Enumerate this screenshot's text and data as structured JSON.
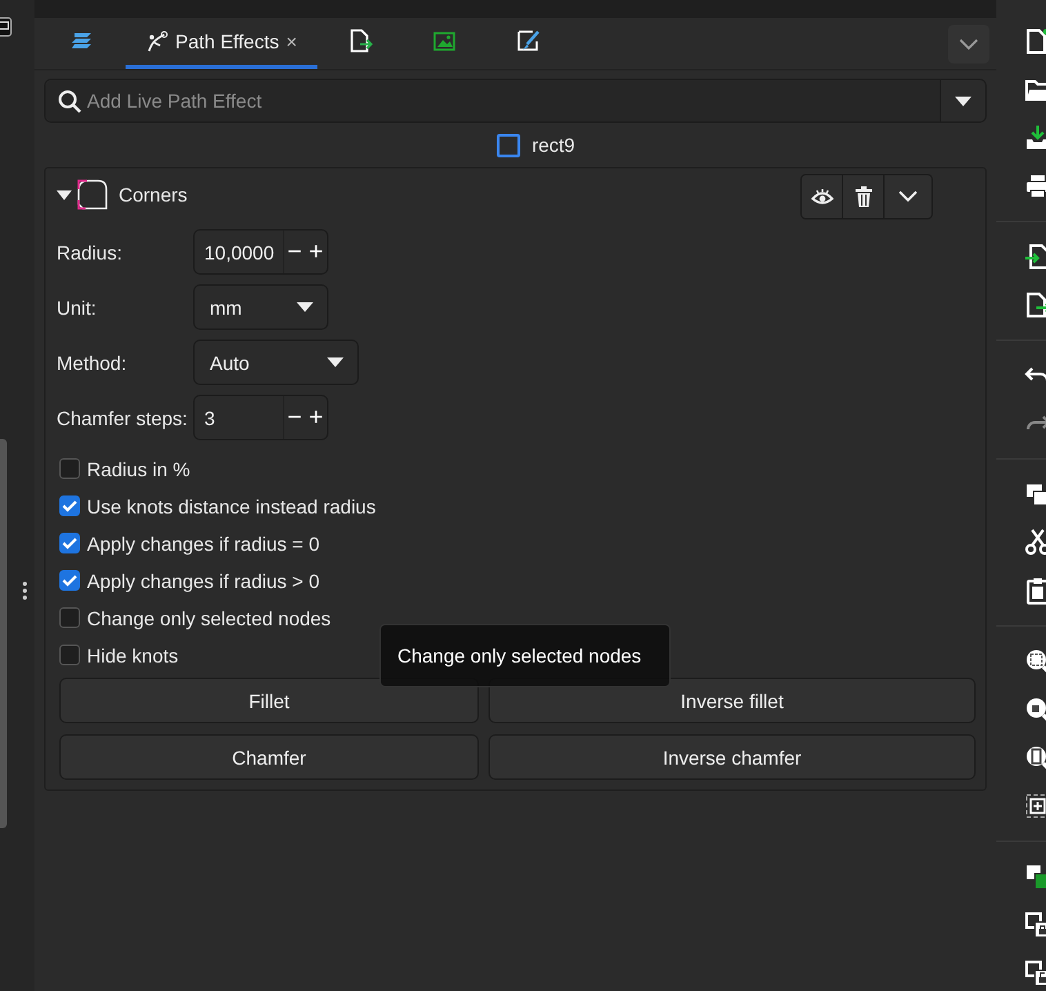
{
  "tabs": [
    {
      "kind": "layers",
      "selected": false
    },
    {
      "kind": "path-effects",
      "label": "Path Effects",
      "close": "×",
      "selected": true
    },
    {
      "kind": "export",
      "selected": false
    },
    {
      "kind": "image",
      "selected": false
    },
    {
      "kind": "brush",
      "selected": false
    }
  ],
  "search": {
    "placeholder": "Add Live Path Effect"
  },
  "object": {
    "label": "rect9"
  },
  "effect": {
    "name": "Corners",
    "expanded": true,
    "params": [
      {
        "kind": "spin",
        "label": "Radius:",
        "value": "10,0000",
        "minus": "−",
        "plus": "+"
      },
      {
        "kind": "dropdown",
        "label": "Unit:",
        "value": "mm"
      },
      {
        "kind": "dropdown",
        "label": "Method:",
        "value": "Auto"
      },
      {
        "kind": "spin",
        "label": "Chamfer steps:",
        "value": "3",
        "minus": "−",
        "plus": "+"
      }
    ],
    "options": [
      {
        "label": "Radius in %",
        "checked": false
      },
      {
        "label": "Use knots distance instead radius",
        "checked": true
      },
      {
        "label": "Apply changes if radius = 0",
        "checked": true
      },
      {
        "label": "Apply changes if radius > 0",
        "checked": true
      },
      {
        "label": "Change only selected nodes",
        "checked": false
      },
      {
        "label": "Hide knots",
        "checked": false
      }
    ],
    "buttons": [
      "Fillet",
      "Inverse fillet",
      "Chamfer",
      "Inverse chamfer"
    ]
  },
  "tooltip": "Change only selected nodes"
}
